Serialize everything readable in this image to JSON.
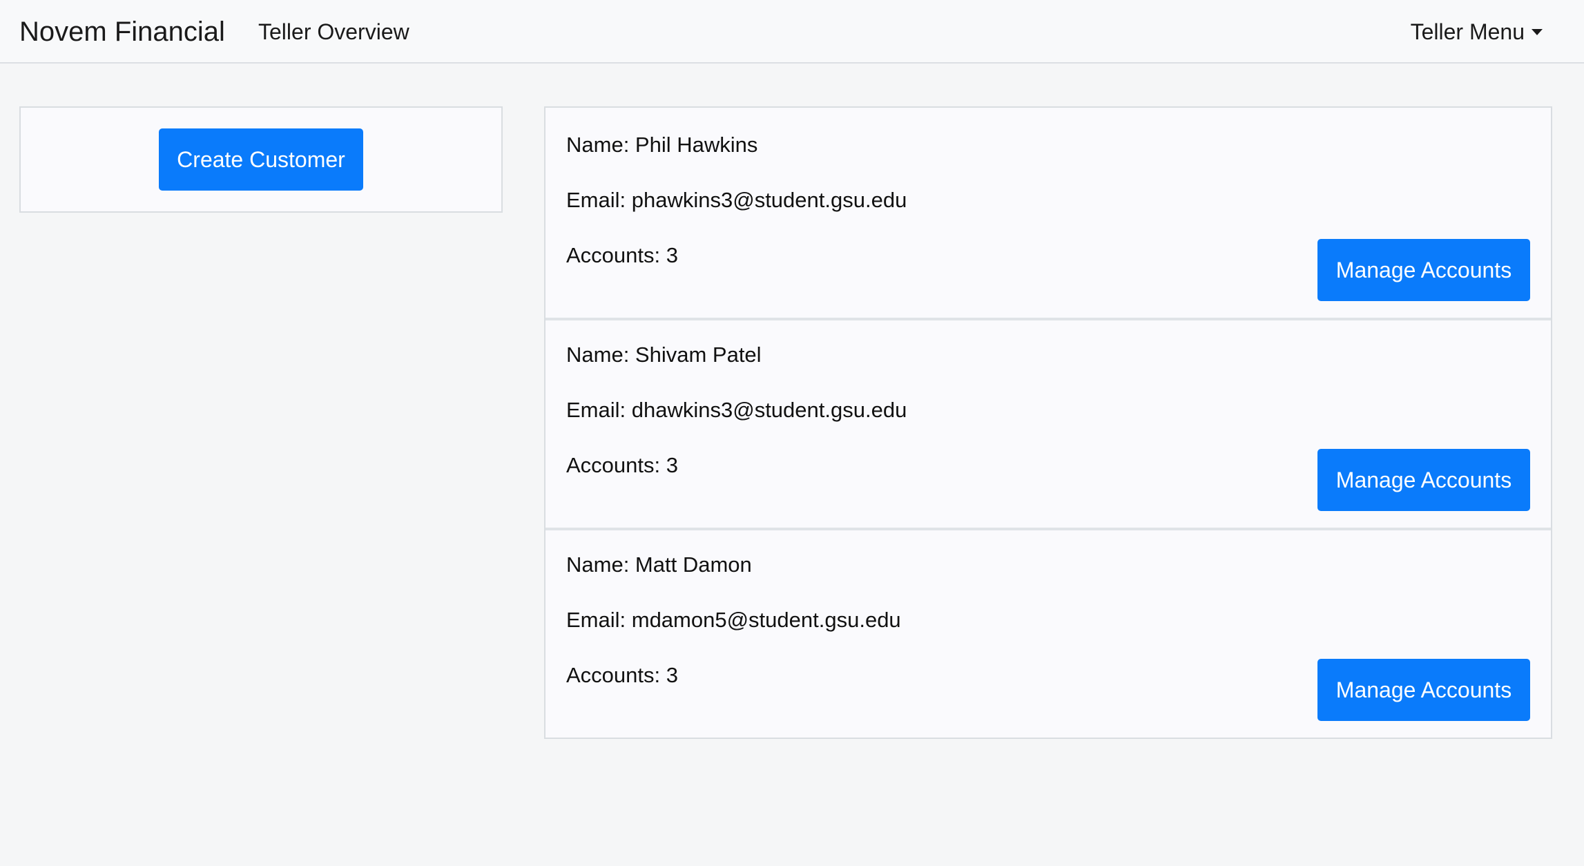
{
  "navbar": {
    "brand": "Novem Financial",
    "link": "Teller Overview",
    "menu_label": "Teller Menu"
  },
  "sidebar": {
    "create_label": "Create Customer"
  },
  "customers": [
    {
      "name": "Name: Phil Hawkins",
      "email": "Email: phawkins3@student.gsu.edu",
      "accounts": "Accounts: 3",
      "manage_label": "Manage Accounts"
    },
    {
      "name": "Name: Shivam Patel",
      "email": "Email: dhawkins3@student.gsu.edu",
      "accounts": "Accounts: 3",
      "manage_label": "Manage Accounts"
    },
    {
      "name": "Name: Matt Damon",
      "email": "Email: mdamon5@student.gsu.edu",
      "accounts": "Accounts: 3",
      "manage_label": "Manage Accounts"
    }
  ],
  "colors": {
    "primary": "#0a7bfb",
    "navbar_bg": "#f8f9fa",
    "page_bg": "#f5f6f7"
  }
}
